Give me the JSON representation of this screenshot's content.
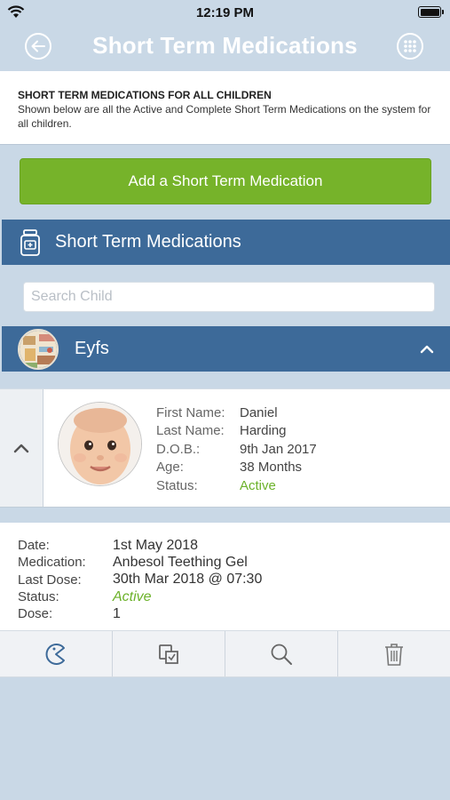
{
  "status_bar": {
    "time": "12:19 PM"
  },
  "nav": {
    "title": "Short Term Medications",
    "back_icon": "back-arrow-icon",
    "menu_icon": "grid-menu-icon"
  },
  "info": {
    "heading": "SHORT TERM MEDICATIONS FOR ALL CHILDREN",
    "description": "Shown below are all the Active and Complete Short Term Medications on the system for all children."
  },
  "add_button": {
    "label": "Add a Short Term Medication"
  },
  "section": {
    "title": "Short Term Medications",
    "icon": "medicine-bottle-icon"
  },
  "search": {
    "placeholder": "Search Child",
    "value": ""
  },
  "group": {
    "name": "Eyfs"
  },
  "child": {
    "fields": [
      {
        "label": "First Name:",
        "value": "Daniel"
      },
      {
        "label": "Last Name:",
        "value": "Harding"
      },
      {
        "label": "D.O.B.:",
        "value": "9th Jan 2017"
      },
      {
        "label": "Age:",
        "value": "38 Months"
      },
      {
        "label": "Status:",
        "value": "Active"
      }
    ]
  },
  "medication": {
    "rows": [
      {
        "label": "Date:",
        "value": "1st May 2018"
      },
      {
        "label": "Medication:",
        "value": "Anbesol Teething Gel"
      },
      {
        "label": "Last Dose:",
        "value": "30th Mar 2018 @ 07:30"
      },
      {
        "label": "Status:",
        "value": "Active"
      },
      {
        "label": "Dose:",
        "value": "1"
      }
    ]
  },
  "actions": [
    "administer-icon",
    "copy-icon",
    "search-icon",
    "trash-icon"
  ],
  "colors": {
    "nav_blue": "#3d6a99",
    "background": "#c9d8e6",
    "green": "#76b32a",
    "active_green": "#6cb22a"
  }
}
